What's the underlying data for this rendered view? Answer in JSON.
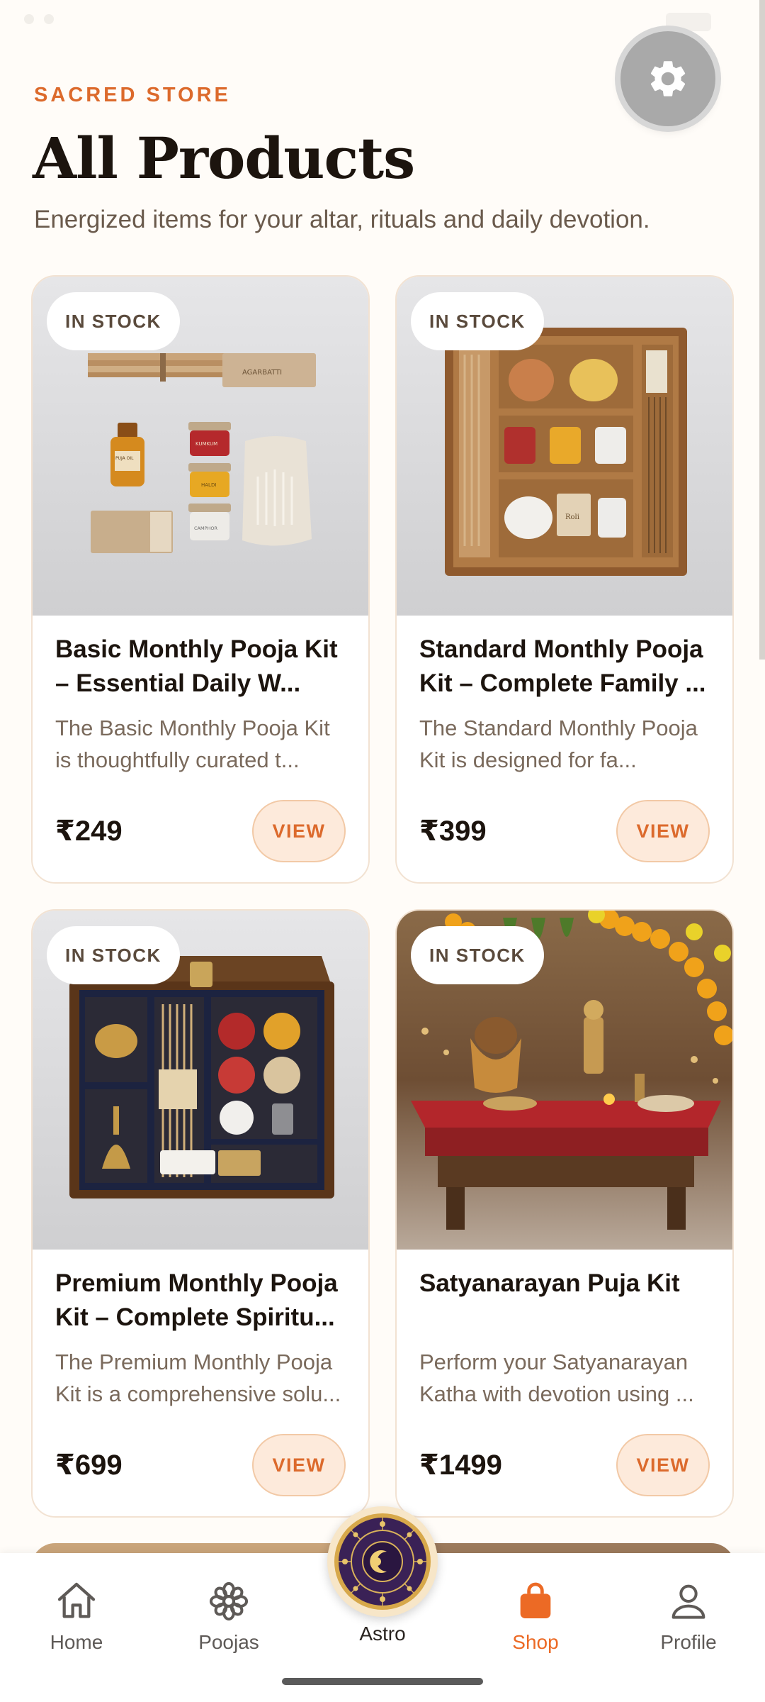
{
  "header": {
    "eyebrow": "SACRED STORE",
    "title": "All Products",
    "subtitle": "Energized items for your altar, rituals and daily devotion."
  },
  "products": [
    {
      "badge": "IN STOCK",
      "title": "Basic Monthly Pooja Kit – Essential Daily W...",
      "description": "The Basic Monthly Pooja Kit is thoughtfully curated t...",
      "price": "₹249",
      "cta": "VIEW",
      "image_labels": [
        "AGARBATTI",
        "PUJA OIL",
        "KUMKUM",
        "HALDI",
        "CAMPHOR"
      ]
    },
    {
      "badge": "IN STOCK",
      "title": "Standard Monthly Pooja Kit – Complete Family ...",
      "description": "The Standard Monthly Pooja Kit is designed for fa...",
      "price": "₹399",
      "cta": "VIEW",
      "image_labels": [
        "Roli"
      ]
    },
    {
      "badge": "IN STOCK",
      "title": "Premium Monthly Pooja Kit – Complete Spiritu...",
      "description": "The Premium Monthly Pooja Kit is a comprehensive solu...",
      "price": "₹699",
      "cta": "VIEW",
      "image_labels": []
    },
    {
      "badge": "IN STOCK",
      "title": "Satyanarayan Puja Kit",
      "description": "Perform your Satyanarayan Katha with devotion using ...",
      "price": "₹1499",
      "cta": "VIEW",
      "image_labels": []
    }
  ],
  "nav": {
    "items": [
      {
        "label": "Home",
        "icon": "home-icon",
        "active": false
      },
      {
        "label": "Poojas",
        "icon": "flower-icon",
        "active": false
      },
      {
        "label": "Astro",
        "icon": "zodiac-wheel-icon",
        "active": false
      },
      {
        "label": "Shop",
        "icon": "shopping-bag-icon",
        "active": true
      },
      {
        "label": "Profile",
        "icon": "person-icon",
        "active": false
      }
    ]
  },
  "colors": {
    "accent": "#DC6A2C",
    "nav_active": "#EC6A25",
    "background": "#FFFCF8",
    "badge_text": "#5A4A3C"
  }
}
